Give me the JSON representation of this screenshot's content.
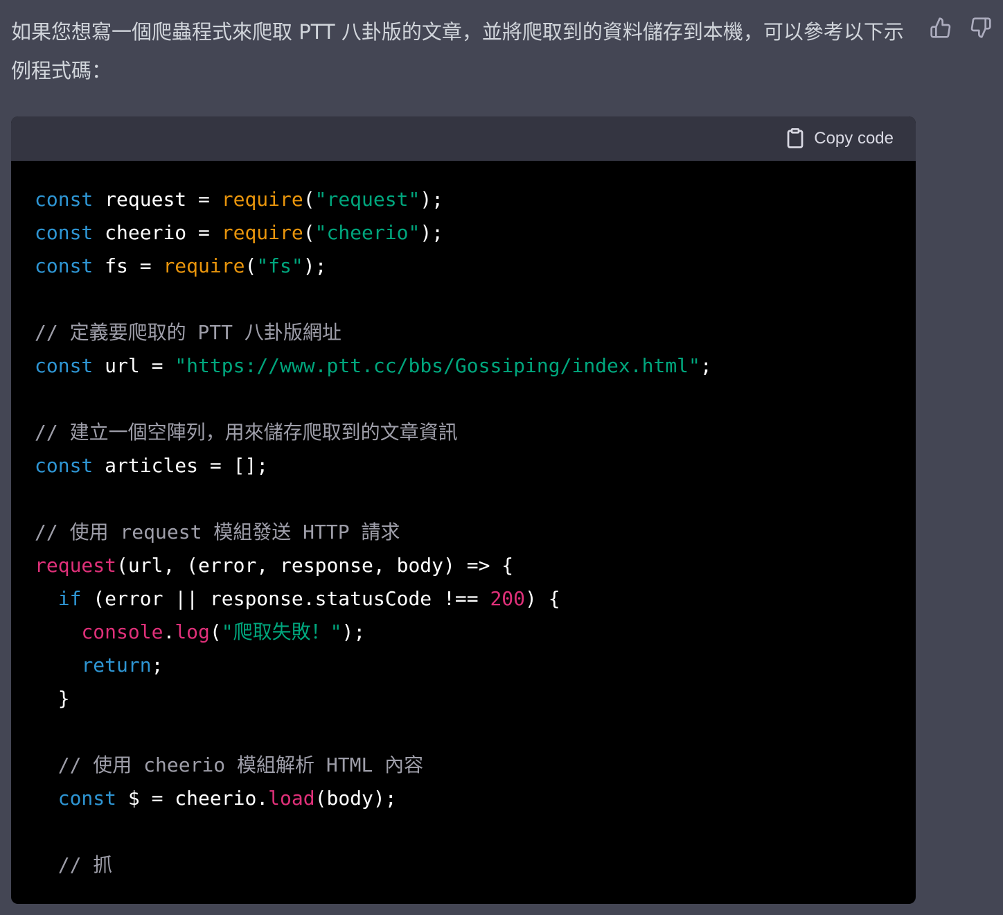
{
  "message": {
    "intro_text": "如果您想寫一個爬蟲程式來爬取 PTT 八卦版的文章，並將爬取到的資料儲存到本機，可以參考以下示例程式碼："
  },
  "feedback": {
    "thumbs_up_icon": "thumbs-up-icon",
    "thumbs_down_icon": "thumbs-down-icon"
  },
  "code_block": {
    "copy_label": "Copy code",
    "copy_icon": "clipboard-icon",
    "background_color": "#000000",
    "header_color": "#343541",
    "colors": {
      "keyword": "#2e95d3",
      "function": "#e9950c",
      "string": "#00a67d",
      "comment": "#9e9ea9",
      "identifier_red": "#df3079"
    },
    "lines": [
      [
        {
          "t": "const",
          "c": "kw"
        },
        {
          "t": " request = "
        },
        {
          "t": "require",
          "c": "fn"
        },
        {
          "t": "("
        },
        {
          "t": "\"request\"",
          "c": "str"
        },
        {
          "t": ");"
        }
      ],
      [
        {
          "t": "const",
          "c": "kw"
        },
        {
          "t": " cheerio = "
        },
        {
          "t": "require",
          "c": "fn"
        },
        {
          "t": "("
        },
        {
          "t": "\"cheerio\"",
          "c": "str"
        },
        {
          "t": ");"
        }
      ],
      [
        {
          "t": "const",
          "c": "kw"
        },
        {
          "t": " fs = "
        },
        {
          "t": "require",
          "c": "fn"
        },
        {
          "t": "("
        },
        {
          "t": "\"fs\"",
          "c": "str"
        },
        {
          "t": ");"
        }
      ],
      [],
      [
        {
          "t": "// 定義要爬取的 PTT 八卦版網址",
          "c": "cm"
        }
      ],
      [
        {
          "t": "const",
          "c": "kw"
        },
        {
          "t": " url = "
        },
        {
          "t": "\"https://www.ptt.cc/bbs/Gossiping/index.html\"",
          "c": "str"
        },
        {
          "t": ";"
        }
      ],
      [],
      [
        {
          "t": "// 建立一個空陣列，用來儲存爬取到的文章資訊",
          "c": "cm"
        }
      ],
      [
        {
          "t": "const",
          "c": "kw"
        },
        {
          "t": " articles = [];"
        }
      ],
      [],
      [
        {
          "t": "// 使用 request 模組發送 HTTP 請求",
          "c": "cm"
        }
      ],
      [
        {
          "t": "request",
          "c": "red"
        },
        {
          "t": "(url, (error, response, body) => {"
        }
      ],
      [
        {
          "t": "  "
        },
        {
          "t": "if",
          "c": "kw"
        },
        {
          "t": " (error || response.statusCode !== "
        },
        {
          "t": "200",
          "c": "num"
        },
        {
          "t": ") {"
        }
      ],
      [
        {
          "t": "    "
        },
        {
          "t": "console",
          "c": "red"
        },
        {
          "t": "."
        },
        {
          "t": "log",
          "c": "red"
        },
        {
          "t": "("
        },
        {
          "t": "\"爬取失敗！\"",
          "c": "str"
        },
        {
          "t": ");"
        }
      ],
      [
        {
          "t": "    "
        },
        {
          "t": "return",
          "c": "kw"
        },
        {
          "t": ";"
        }
      ],
      [
        {
          "t": "  }"
        }
      ],
      [],
      [
        {
          "t": "  "
        },
        {
          "t": "// 使用 cheerio 模組解析 HTML 內容",
          "c": "cm"
        }
      ],
      [
        {
          "t": "  "
        },
        {
          "t": "const",
          "c": "kw"
        },
        {
          "t": " $ = cheerio."
        },
        {
          "t": "load",
          "c": "red"
        },
        {
          "t": "(body);"
        }
      ],
      [],
      [
        {
          "t": "  "
        },
        {
          "t": "// 抓",
          "c": "cm"
        }
      ]
    ]
  }
}
